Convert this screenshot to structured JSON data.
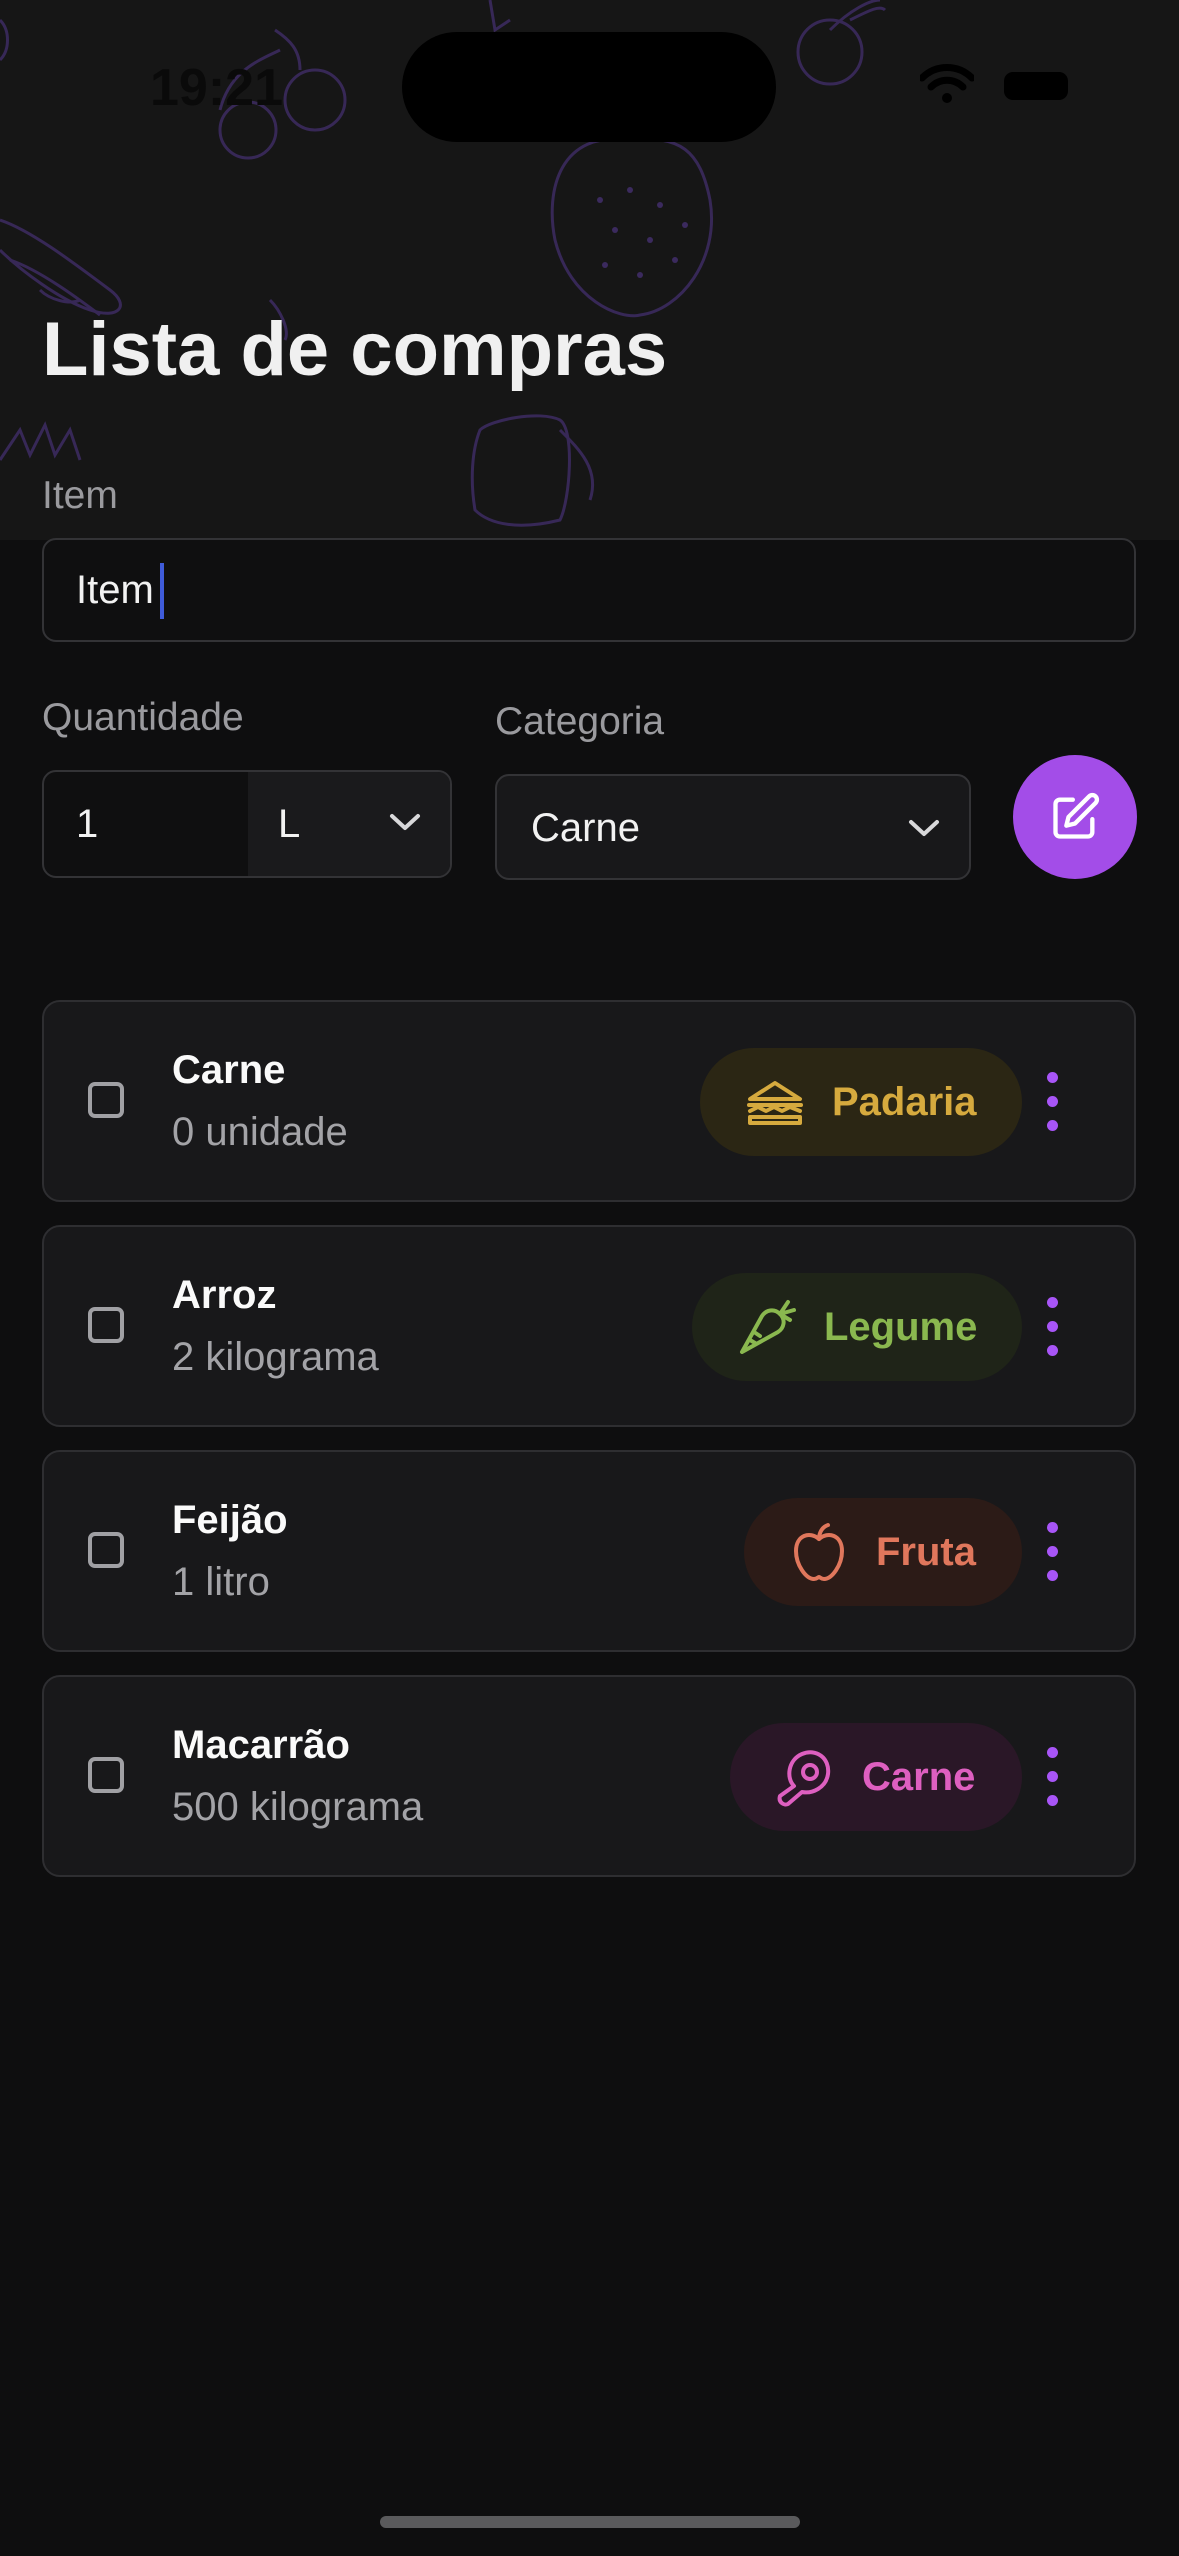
{
  "status_bar": {
    "time": "19:21"
  },
  "header": {
    "title": "Lista de compras"
  },
  "form": {
    "item_label": "Item",
    "item_value": "Item",
    "quantity_label": "Quantidade",
    "quantity_value": "1",
    "unit_value": "L",
    "category_label": "Categoria",
    "category_value": "Carne",
    "submit_icon": "edit-icon"
  },
  "items": [
    {
      "name": "Carne",
      "qty": "0 unidade",
      "category": "Padaria",
      "icon": "sandwich-icon",
      "color": "#d6aa3e",
      "bg": "#2b2614"
    },
    {
      "name": "Arroz",
      "qty": "2 kilograma",
      "category": "Legume",
      "icon": "carrot-icon",
      "color": "#8ab84f",
      "bg": "#1f2418"
    },
    {
      "name": "Feijão",
      "qty": "1 litro",
      "category": "Fruta",
      "icon": "apple-icon",
      "color": "#e0775c",
      "bg": "#2c1b17"
    },
    {
      "name": "Macarrão",
      "qty": "500 kilograma",
      "category": "Carne",
      "icon": "meat-icon",
      "color": "#de5fc0",
      "bg": "#2a1727"
    }
  ],
  "colors": {
    "accent": "#a34de8",
    "background": "#0e0e0f",
    "card": "#18181a"
  }
}
